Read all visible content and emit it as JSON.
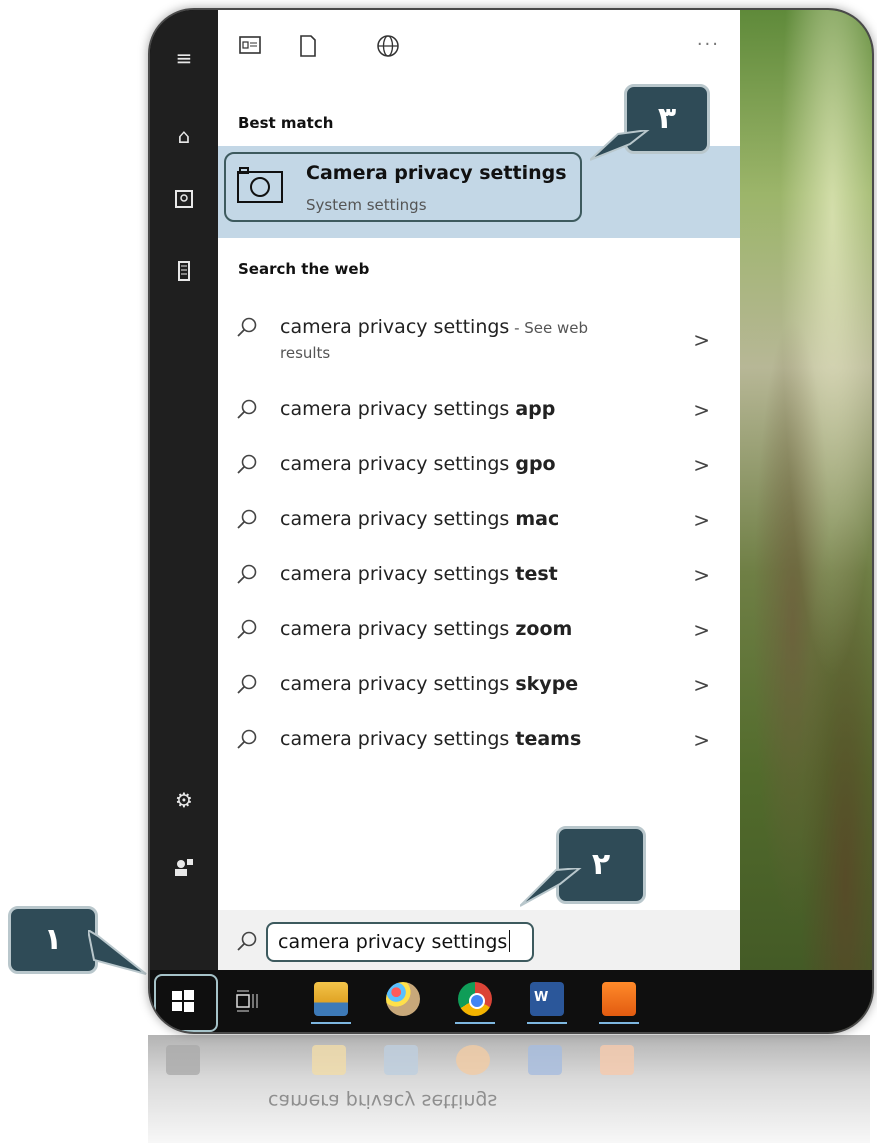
{
  "toolbar": {
    "more": "···"
  },
  "sections": {
    "best_match": "Best match",
    "search_web": "Search the web"
  },
  "best": {
    "title": "Camera privacy settings",
    "subtitle": "System settings"
  },
  "web": {
    "first_prefix": "camera privacy settings",
    "first_suffix": " - See web",
    "first_results": "results",
    "rows": [
      {
        "prefix": "camera privacy settings ",
        "bold": "app"
      },
      {
        "prefix": "camera privacy settings ",
        "bold": "gpo"
      },
      {
        "prefix": "camera privacy settings ",
        "bold": "mac"
      },
      {
        "prefix": "camera privacy settings ",
        "bold": "test"
      },
      {
        "prefix": "camera privacy settings ",
        "bold": "zoom"
      },
      {
        "prefix": "camera privacy settings ",
        "bold": "skype"
      },
      {
        "prefix": "camera privacy settings ",
        "bold": "teams"
      }
    ],
    "chevron": ">"
  },
  "search": {
    "value": "camera privacy settings"
  },
  "callouts": {
    "one": "١",
    "two": "٢",
    "three": "٣"
  },
  "reflection": {
    "text": "camera privacy settings"
  },
  "colors": {
    "accent": "#2f4b57",
    "highlight": "#c3d7e6",
    "underline": "#7eb7e0"
  }
}
